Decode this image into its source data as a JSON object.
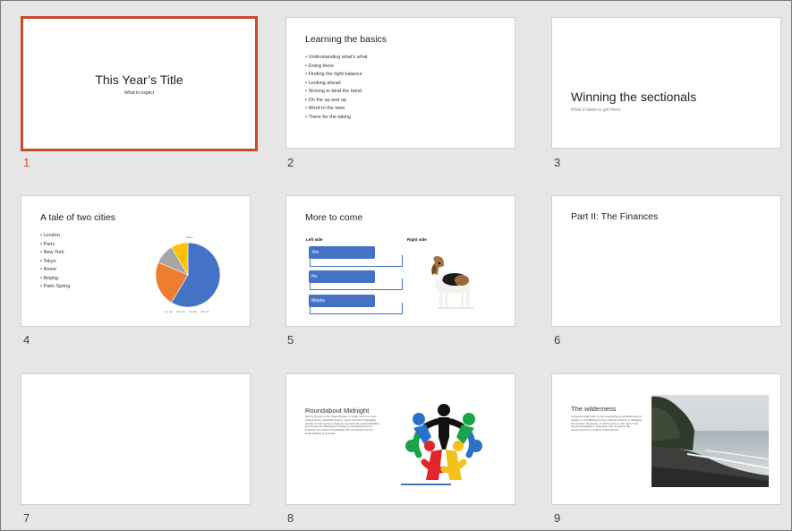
{
  "slides": [
    {
      "number": "1",
      "title": "This Year’s Title",
      "subtitle": "What to expect"
    },
    {
      "number": "2",
      "title": "Learning the basics",
      "bullets": [
        "Understanding what’s what",
        "Going there",
        "Finding the right balance",
        "Looking ahead",
        "Striving to beat the band",
        "On the up and up",
        "Word to the wise",
        "There for the taking"
      ]
    },
    {
      "number": "3",
      "title": "Winning the sectionals",
      "subtitle": "What it takes to get there"
    },
    {
      "number": "4",
      "title": "A tale of two cities",
      "bullets": [
        "London",
        "Paris",
        "New York",
        "Tokyo",
        "Rome",
        "Beijing",
        "Palm Spring"
      ],
      "chart_title": "Sales",
      "legend": [
        "1st Qtr",
        "2nd Qtr",
        "3rd Qtr",
        "4th Qtr"
      ]
    },
    {
      "number": "5",
      "title": "More to come",
      "left_label": "Left side",
      "right_label": "Right side",
      "items": [
        "Yes",
        "No",
        "Maybe"
      ]
    },
    {
      "number": "6",
      "title": "Part II: The Finances"
    },
    {
      "number": "7"
    },
    {
      "number": "8",
      "title": "Roundabout Midnight",
      "body": "We the People of the United States, in Order to form a more perfect Union, establish Justice, insure domestic Tranquility, provide for the common defence, promote the general Welfare, and secure the Blessings of Liberty to ourselves and our Posterity, do ordain and establish this Constitution for the United States of America."
    },
    {
      "number": "9",
      "title": "The wilderness",
      "body": "Congress shall make no law respecting an establishment of religion, or prohibiting the free exercise thereof; or abridging the freedom of speech, or of the press; or the right of the people peaceably to assemble, and to petition the Government for a redress of grievances."
    }
  ],
  "chart_data": {
    "type": "pie",
    "title": "Sales",
    "categories": [
      "1st Qtr",
      "2nd Qtr",
      "3rd Qtr",
      "4th Qtr"
    ],
    "values": [
      8.2,
      3.2,
      1.4,
      1.2
    ],
    "colors": [
      "#4472c4",
      "#ed7d31",
      "#a5a5a5",
      "#ffc000"
    ]
  },
  "selected_index": 0,
  "accent_color": "#c94a30"
}
